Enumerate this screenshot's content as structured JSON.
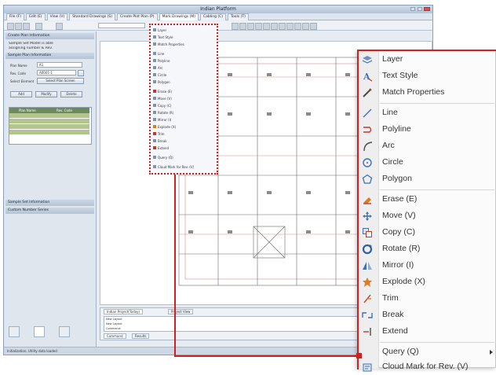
{
  "window": {
    "title": "Indian Platform",
    "tabs": [
      "File (F)",
      "Edit (E)",
      "View (V)",
      "Standard Drawings (S)",
      "Create Plot Plan (P)",
      "Mark Drawings (M)",
      "Cabling (C)",
      "Tools (T)"
    ]
  },
  "left_panel": {
    "header": "Create Plan Information",
    "intro_line1": "Sample Set Model is able",
    "intro_line2": "assigning number & Rev.",
    "section_title": "Sample Plan Information",
    "field_name_label": "Plan Name",
    "field_name_value": "A1",
    "field_rev_label": "Rev. Code",
    "field_rev_value": "A0001-1",
    "select_label": "Select Element",
    "select_button": "Select Plan Screen",
    "buttons": [
      "Add",
      "Modify",
      "Delete"
    ],
    "grid_headers": [
      "Plan Name",
      "Rev. Code"
    ],
    "section2": "Sample Set Information",
    "section3": "Custom Number Series"
  },
  "command": {
    "tabs": [
      "Indian Project(Today)",
      "Project View"
    ],
    "lines": [
      "New Layout",
      "New Layout",
      "Command:"
    ],
    "buttons": [
      "Command",
      "Results"
    ]
  },
  "status": {
    "text": "Initialization, Utility data loaded"
  },
  "small_menu": {
    "items": [
      "Layer",
      "Text Style",
      "Match Properties",
      "Line",
      "Polyline",
      "Arc",
      "Circle",
      "Polygon",
      "Erase (E)",
      "Move (V)",
      "Copy (C)",
      "Rotate (R)",
      "Mirror (I)",
      "Explode (X)",
      "Trim",
      "Break",
      "Extend",
      "Query (Q)",
      "Cloud Mark for Rev. (V)"
    ]
  },
  "context_menu": {
    "items": [
      {
        "label": "Layer",
        "icon": "layer-icon"
      },
      {
        "label": "Text Style",
        "icon": "text-style-icon"
      },
      {
        "label": "Match Properties",
        "icon": "match-properties-icon"
      },
      {
        "label": "Line",
        "icon": "line-icon"
      },
      {
        "label": "Polyline",
        "icon": "polyline-icon"
      },
      {
        "label": "Arc",
        "icon": "arc-icon"
      },
      {
        "label": "Circle",
        "icon": "circle-icon"
      },
      {
        "label": "Polygon",
        "icon": "polygon-icon"
      },
      {
        "label": "Erase (E)",
        "icon": "erase-icon"
      },
      {
        "label": "Move (V)",
        "icon": "move-icon"
      },
      {
        "label": "Copy (C)",
        "icon": "copy-icon"
      },
      {
        "label": "Rotate (R)",
        "icon": "rotate-icon"
      },
      {
        "label": "Mirror (I)",
        "icon": "mirror-icon"
      },
      {
        "label": "Explode (X)",
        "icon": "explode-icon"
      },
      {
        "label": "Trim",
        "icon": "trim-icon"
      },
      {
        "label": "Break",
        "icon": "break-icon"
      },
      {
        "label": "Extend",
        "icon": "extend-icon"
      },
      {
        "label": "Query (Q)",
        "icon": "query-icon"
      },
      {
        "label": "Cloud Mark for Rev. (V)",
        "icon": "cloud-mark-icon"
      }
    ]
  },
  "colors": {
    "callout_red": "#d21f1f",
    "icon_blue": "#3f6fb5",
    "icon_red": "#c0392b",
    "icon_orange": "#e07b1c"
  }
}
